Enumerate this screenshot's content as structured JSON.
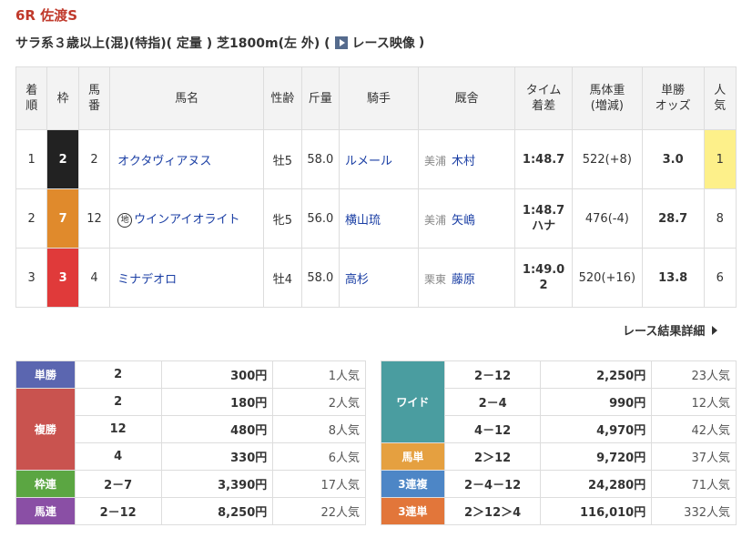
{
  "race": {
    "title": "6R 佐渡S",
    "conditions_prefix": "サラ系３歳以上(混)(特指)( 定量 ) 芝1800m(左 外) (",
    "video_label": "レース映像",
    "conditions_suffix": ")"
  },
  "colors": {
    "accent_red": "#c0392b",
    "link_blue": "#1a3ea4",
    "favorite_highlight": "#fdf08a"
  },
  "result_table": {
    "headers": {
      "rank": "着\n順",
      "waku": "枠",
      "umaban": "馬\n番",
      "horse": "馬名",
      "sex_age": "性齢",
      "weight": "斤量",
      "jockey": "騎手",
      "trainer": "厩舎",
      "time": "タイム\n着差",
      "body_weight": "馬体重\n(増減)",
      "odds": "単勝\nオッズ",
      "popularity": "人\n気"
    },
    "rows": [
      {
        "rank": "1",
        "waku": "2",
        "waku_color": "#222222",
        "umaban": "2",
        "local_mark": "",
        "horse": "オクタヴィアヌス",
        "sex_age": "牡5",
        "weight": "58.0",
        "jockey": "ルメール",
        "trainer_loc": "美浦",
        "trainer": "木村",
        "time": "1:48.7",
        "margin": "",
        "body_weight": "522(+8)",
        "odds": "3.0",
        "popularity": "1"
      },
      {
        "rank": "2",
        "waku": "7",
        "waku_color": "#e08a2c",
        "umaban": "12",
        "local_mark": "地",
        "horse": "ウインアイオライト",
        "sex_age": "牝5",
        "weight": "56.0",
        "jockey": "横山琉",
        "trainer_loc": "美浦",
        "trainer": "矢嶋",
        "time": "1:48.7",
        "margin": "ハナ",
        "body_weight": "476(-4)",
        "odds": "28.7",
        "popularity": "8"
      },
      {
        "rank": "3",
        "waku": "3",
        "waku_color": "#e03a3a",
        "umaban": "4",
        "local_mark": "",
        "horse": "ミナデオロ",
        "sex_age": "牡4",
        "weight": "58.0",
        "jockey": "高杉",
        "trainer_loc": "栗東",
        "trainer": "藤原",
        "time": "1:49.0",
        "margin": "2",
        "body_weight": "520(+16)",
        "odds": "13.8",
        "popularity": "6"
      }
    ]
  },
  "detail_link": "レース結果詳細",
  "payouts_left": [
    {
      "label": "単勝",
      "color": "#5b66b0",
      "entries": [
        {
          "comb": "2",
          "amount": "300円",
          "pop": "1人気"
        }
      ]
    },
    {
      "label": "複勝",
      "color": "#c9534f",
      "entries": [
        {
          "comb": "2",
          "amount": "180円",
          "pop": "2人気"
        },
        {
          "comb": "12",
          "amount": "480円",
          "pop": "8人気"
        },
        {
          "comb": "4",
          "amount": "330円",
          "pop": "6人気"
        }
      ]
    },
    {
      "label": "枠連",
      "color": "#5ba642",
      "entries": [
        {
          "comb": "2－7",
          "amount": "3,390円",
          "pop": "17人気"
        }
      ]
    },
    {
      "label": "馬連",
      "color": "#8a4fa5",
      "entries": [
        {
          "comb": "2－12",
          "amount": "8,250円",
          "pop": "22人気"
        }
      ]
    }
  ],
  "payouts_right": [
    {
      "label": "ワイド",
      "color": "#4a9da0",
      "entries": [
        {
          "comb": "2－12",
          "amount": "2,250円",
          "pop": "23人気"
        },
        {
          "comb": "2－4",
          "amount": "990円",
          "pop": "12人気"
        },
        {
          "comb": "4－12",
          "amount": "4,970円",
          "pop": "42人気"
        }
      ]
    },
    {
      "label": "馬単",
      "color": "#e5a040",
      "entries": [
        {
          "comb": "2＞12",
          "amount": "9,720円",
          "pop": "37人気"
        }
      ]
    },
    {
      "label": "3連複",
      "color": "#4d86c6",
      "entries": [
        {
          "comb": "2－4－12",
          "amount": "24,280円",
          "pop": "71人気"
        }
      ]
    },
    {
      "label": "3連単",
      "color": "#e2763a",
      "entries": [
        {
          "comb": "2＞12＞4",
          "amount": "116,010円",
          "pop": "332人気"
        }
      ]
    }
  ]
}
